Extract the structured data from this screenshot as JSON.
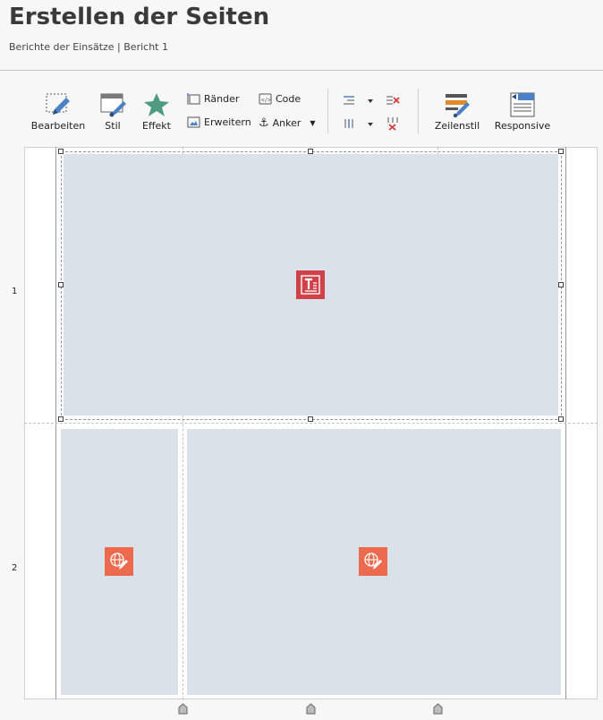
{
  "header": {
    "title": "Erstellen der Seiten",
    "breadcrumb": "Berichte der Einsätze | Bericht 1"
  },
  "toolbar": {
    "bearbeiten": "Bearbeiten",
    "stil": "Stil",
    "effekt": "Effekt",
    "raender": "Ränder",
    "erweitern": "Erweitern",
    "code": "Code",
    "anker": "Anker",
    "zeilenstil": "Zeilenstil",
    "responsive": "Responsive"
  },
  "grid": {
    "row1_label": "1",
    "row2_label": "2"
  },
  "colors": {
    "text_block_badge": "#d0414a",
    "web_block_badge": "#ec6a4d",
    "cell_fill": "#dbe1e8"
  }
}
